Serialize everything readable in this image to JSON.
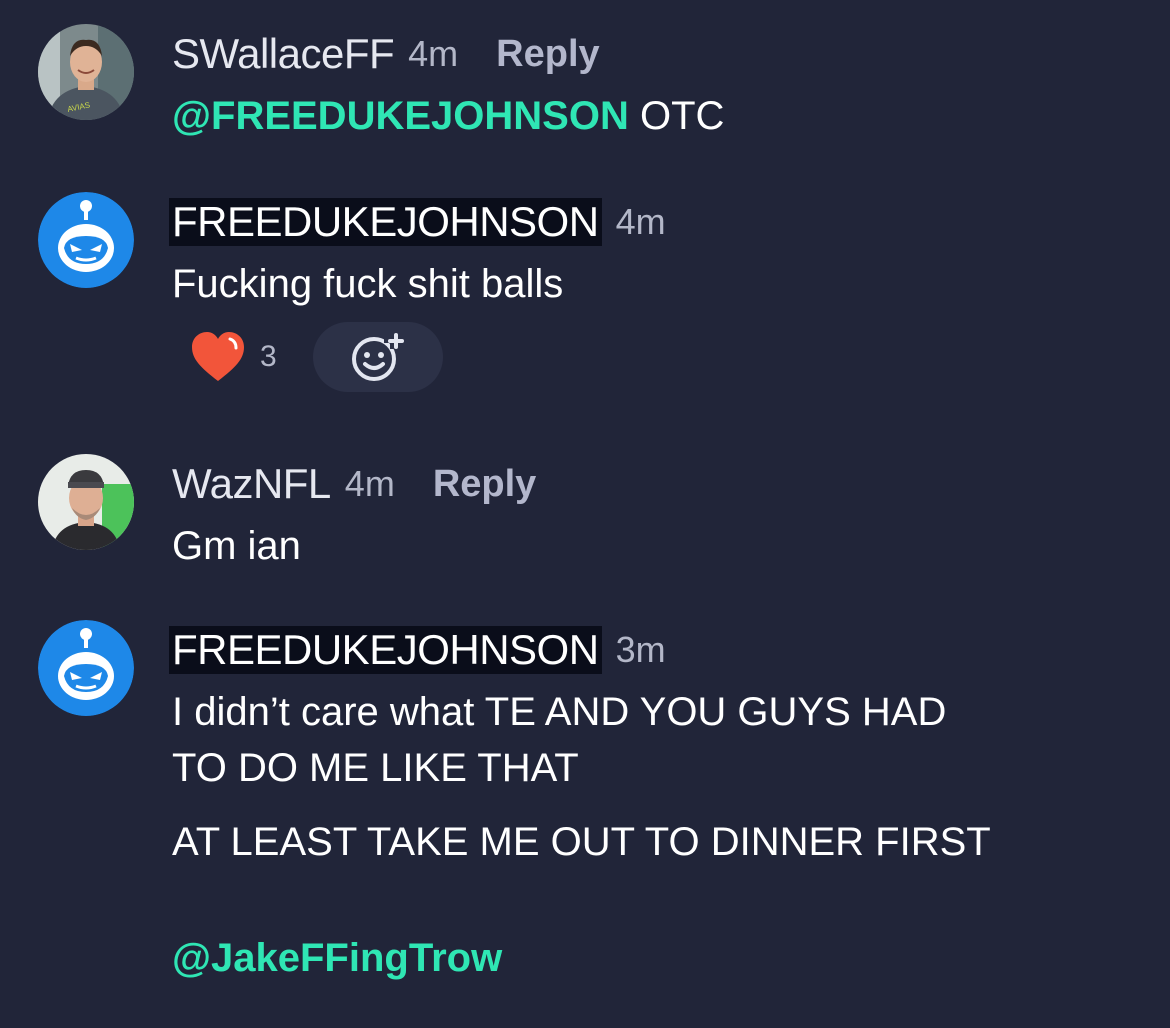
{
  "comments": [
    {
      "username": "SWallaceFF",
      "time": "4m",
      "reply_label": "Reply",
      "mention": "@FREEDUKEJOHNSON",
      "text": "OTC"
    },
    {
      "username": "FREEDUKEJOHNSON",
      "time": "4m",
      "text": "Fucking fuck shit balls",
      "reaction_count": "3"
    },
    {
      "username": "WazNFL",
      "time": "4m",
      "reply_label": "Reply",
      "text": "Gm ian"
    },
    {
      "username": "FREEDUKEJOHNSON",
      "time": "3m",
      "line1": "I didn’t care what TE AND YOU GUYS HAD",
      "line2": "TO DO ME LIKE THAT",
      "line3": "AT LEAST TAKE ME OUT TO DINNER FIRST",
      "mention": "@JakeFFingTrow"
    }
  ],
  "colors": {
    "background": "#212539",
    "mention": "#2fe6b4",
    "bot_avatar": "#1e88e8",
    "heart": "#f2553a"
  },
  "icons": {
    "bot_avatar": "robot-face-icon",
    "reaction": "heart-icon",
    "add_reaction": "smiley-plus-icon"
  }
}
